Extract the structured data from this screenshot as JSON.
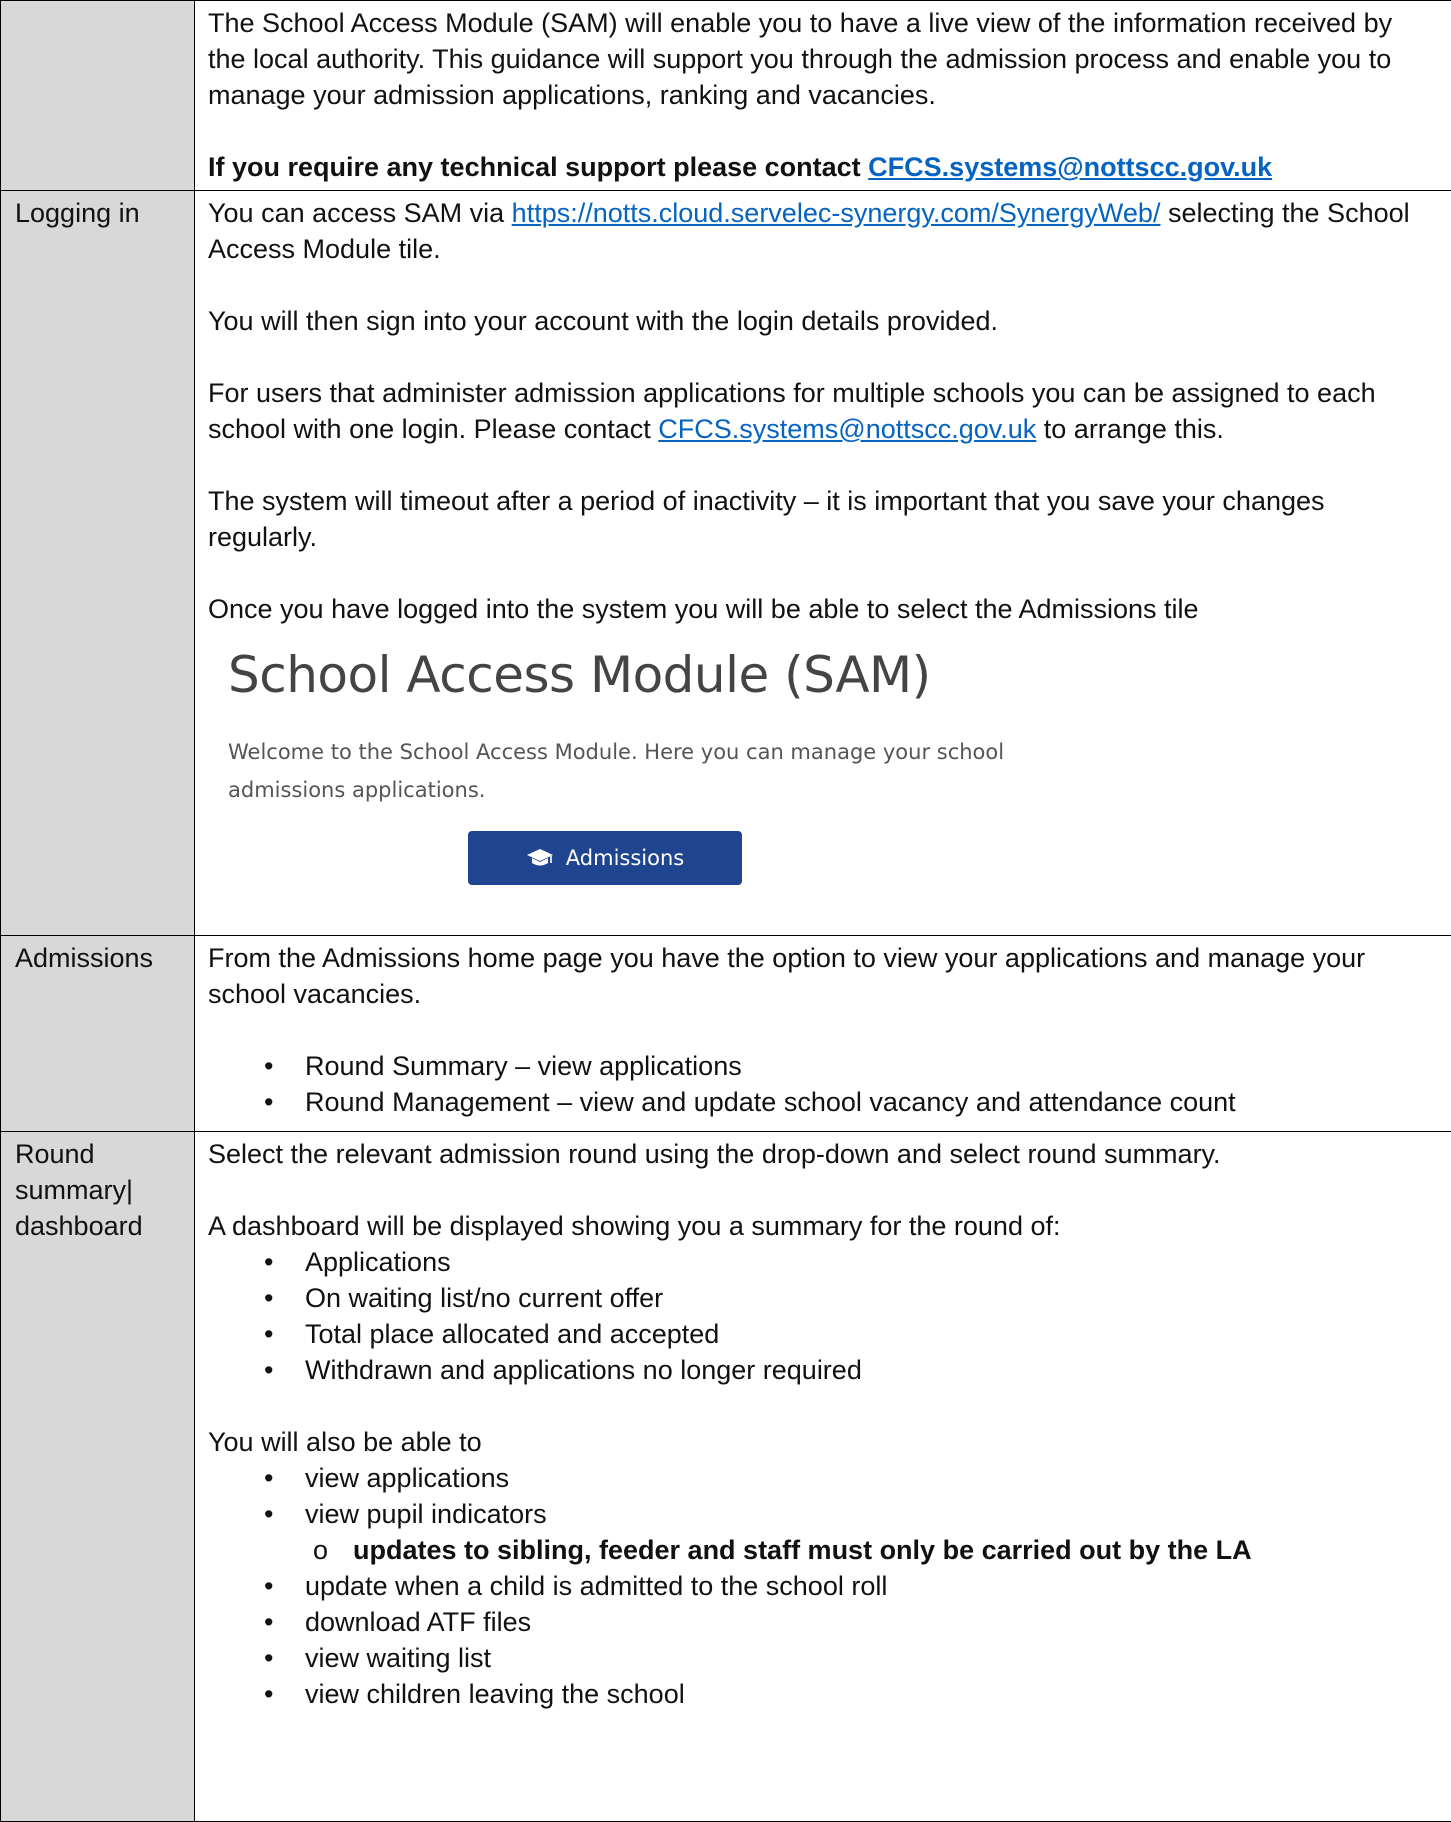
{
  "intro": {
    "paragraph": "The School Access Module (SAM) will enable you to have a live view of the information received by the local authority.  This guidance will support you through the admission process and enable you to manage your admission applications, ranking and vacancies.",
    "support_text": "If you require any technical support please contact ",
    "support_email": "CFCS.systems@nottscc.gov.uk"
  },
  "logging_in": {
    "label": "Logging in",
    "access_prefix": "You can access SAM via  ",
    "access_url": "https://notts.cloud.servelec-synergy.com/SynergyWeb/",
    "access_suffix": " selecting the School Access Module tile.",
    "sign_in": "You will then sign into your account with the login details provided.",
    "multi_prefix": "For users that administer admission applications for multiple schools you can be assigned to each school with one login.  Please contact ",
    "multi_email": "CFCS.systems@nottscc.gov.uk",
    "multi_suffix": " to arrange this.",
    "timeout": "The system will timeout after a period of inactivity – it is important that you save your changes regularly.",
    "once_logged": "Once you have logged into the system you will be able to select the Admissions tile",
    "screenshot": {
      "title": "School Access Module (SAM)",
      "welcome": "Welcome to the School Access Module. Here you can manage your school admissions applications.",
      "button_label": "Admissions",
      "button_icon": "graduation-cap-icon",
      "button_color": "#1f4490"
    }
  },
  "admissions": {
    "label": "Admissions",
    "paragraph": "From the Admissions home page you have the option to view your applications and manage your school vacancies.",
    "items": [
      "Round Summary – view applications",
      "Round Management – view and update school vacancy and attendance count"
    ]
  },
  "round_summary": {
    "label": "Round summary| dashboard",
    "select_text": "Select the relevant admission round using the drop-down and select round summary.",
    "dashboard_text": "A dashboard will be displayed showing you a summary for the round of:",
    "dashboard_items": [
      "Applications",
      "On waiting list/no current offer",
      "Total place allocated and accepted",
      "Withdrawn and applications no longer required"
    ],
    "also_text": "You will also be able to",
    "also_items_a": [
      "view applications",
      "view pupil indicators"
    ],
    "sub_item": "updates to sibling, feeder and staff must only be carried out by the LA",
    "also_items_b": [
      "update when a child is admitted to the school roll",
      "download ATF files",
      "view waiting list",
      "view children leaving the school"
    ]
  }
}
